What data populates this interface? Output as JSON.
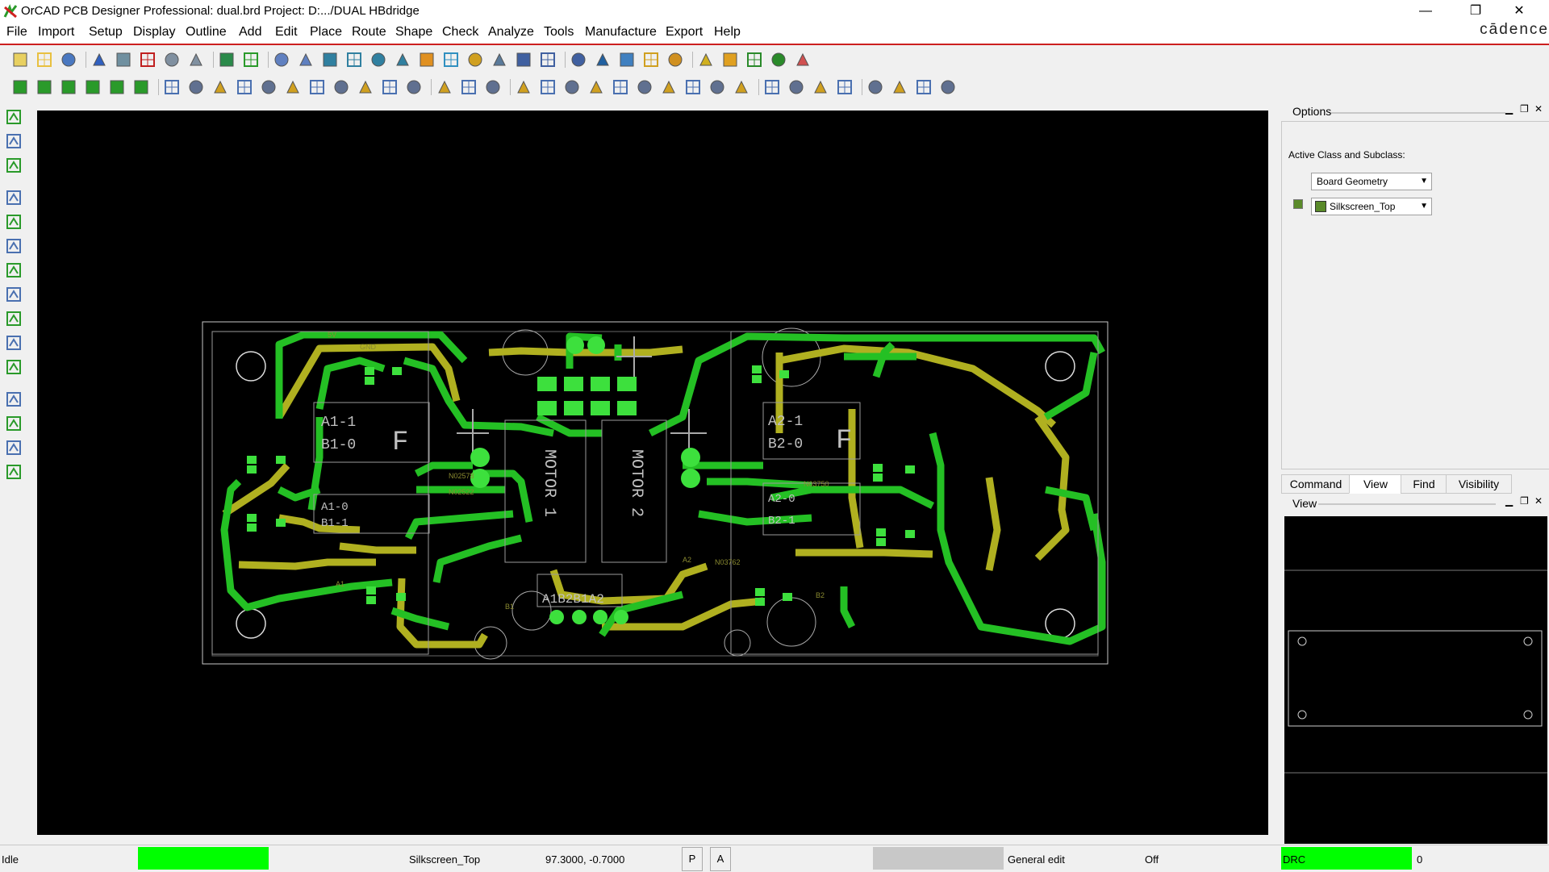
{
  "window": {
    "title": "OrCAD PCB Designer Professional: dual.brd  Project: D:.../DUAL HBdridge",
    "brand": "cādence",
    "controls": [
      "—",
      "❐",
      "✕"
    ]
  },
  "menu": {
    "items": [
      {
        "label": "File"
      },
      {
        "label": "Import"
      },
      {
        "label": "Setup"
      },
      {
        "label": "Display"
      },
      {
        "label": "Outline"
      },
      {
        "label": "Add"
      },
      {
        "label": "Edit"
      },
      {
        "label": "Place"
      },
      {
        "label": "Route"
      },
      {
        "label": "Shape"
      },
      {
        "label": "Check"
      },
      {
        "label": "Analyze"
      },
      {
        "label": "Tools"
      },
      {
        "label": "Manufacture"
      },
      {
        "label": "Export"
      },
      {
        "label": "Help"
      }
    ]
  },
  "options": {
    "title": "Options",
    "active_class_label": "Active Class and Subclass:",
    "class_value": "Board Geometry",
    "subclass_value": "Silkscreen_Top",
    "subclass_color": "#5a8a2a"
  },
  "tabs": {
    "items": [
      "Command",
      "View",
      "Find",
      "Visibility"
    ],
    "active": "View"
  },
  "view_panel": {
    "title": "View"
  },
  "status": {
    "state": "Idle",
    "subclass": "Silkscreen_Top",
    "coords": "97.3000, -0.7000",
    "p_button": "P",
    "a_button": "A",
    "mode": "General edit",
    "off": "Off",
    "drc": "DRC",
    "drc_count": "0",
    "idle_color": "#00ff00",
    "drc_color": "#00ff00"
  },
  "board": {
    "silk_labels": [
      "A1-1",
      "B1-0",
      "A2-1",
      "B2-0",
      "A1-0",
      "B1-1",
      "A2-0",
      "B2-1",
      "MOTOR 1",
      "MOTOR 2",
      "A1B2B1A2",
      "F",
      "F"
    ],
    "net_labels": [
      "GND",
      "5V",
      "A1",
      "B1",
      "A2",
      "B2",
      "N02522",
      "N02578",
      "N03762",
      "N03750"
    ],
    "trace_colors": {
      "top": "#24c024",
      "bottom": "#b0b020",
      "pad": "#3de03d",
      "outline": "#c8c8c8"
    }
  }
}
